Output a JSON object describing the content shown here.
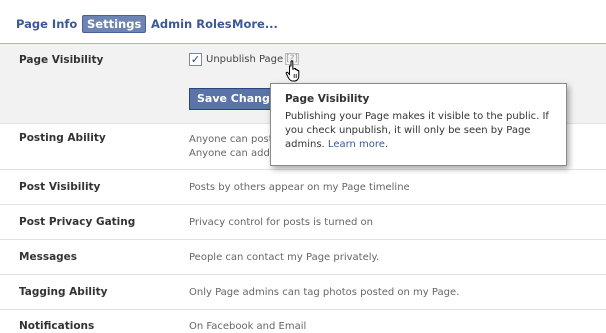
{
  "tabs": [
    {
      "label": "Page Info",
      "selected": false
    },
    {
      "label": "Settings",
      "selected": true
    },
    {
      "label": "Admin Roles",
      "selected": false
    },
    {
      "label": "More...",
      "selected": false
    }
  ],
  "page_visibility": {
    "label": "Page Visibility",
    "checkbox_checked": true,
    "checkbox_mark": "✓",
    "checkbox_label": "Unpublish Page",
    "help_text": "[?]",
    "save_label": "Save Changes"
  },
  "tooltip": {
    "title": "Page Visibility",
    "body": "Publishing your Page makes it visible to the public. If you check unpublish, it will only be seen by Page admins.",
    "link": "Learn more",
    "suffix": "."
  },
  "settings": [
    {
      "label": "Posting Ability",
      "value": "Anyone can post",
      "value2": "Anyone can add"
    },
    {
      "label": "Post Visibility",
      "value": "Posts by others appear on my Page timeline"
    },
    {
      "label": "Post Privacy Gating",
      "value": "Privacy control for posts is turned on"
    },
    {
      "label": "Messages",
      "value": "People can contact my Page privately."
    },
    {
      "label": "Tagging Ability",
      "value": "Only Page admins can tag photos posted on my Page."
    },
    {
      "label": "Notifications",
      "value": "On Facebook and Email"
    }
  ],
  "colors": {
    "link_blue": "#3b5998",
    "tab_selected_bg": "#6d84b4",
    "button_bg": "#5b74a8",
    "row_highlight_bg": "#f2f2f2"
  },
  "icons": {
    "cursor": "hand-pointer-icon",
    "checkbox": "checkmark-icon"
  }
}
